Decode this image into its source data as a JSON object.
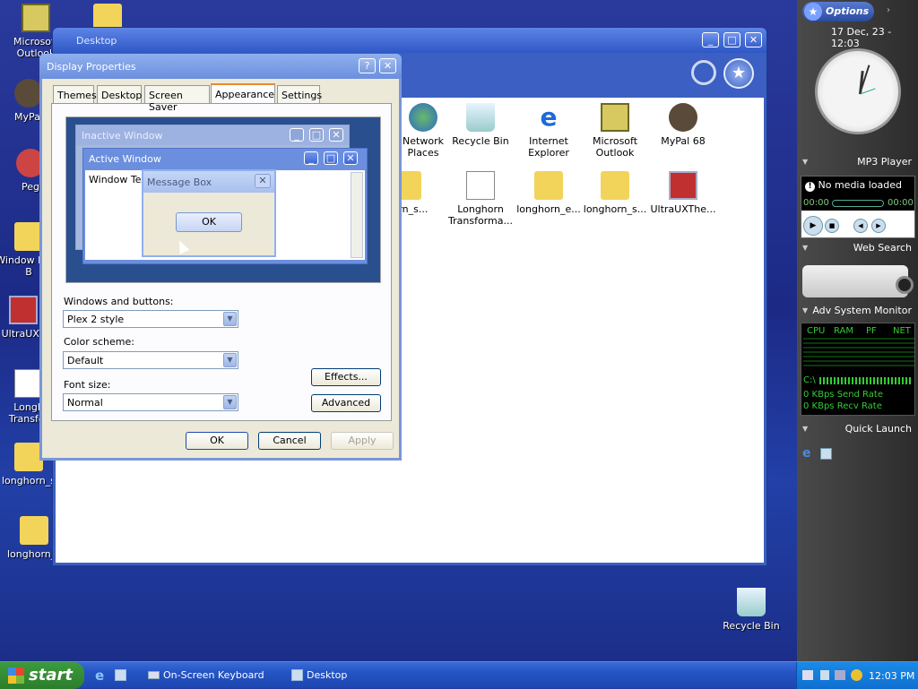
{
  "desktop_icons": [
    {
      "label": "Microsoft Outlook",
      "icon": "outlook-icon"
    },
    {
      "label": "MyPal",
      "icon": "mypal-icon"
    },
    {
      "label": "Peg",
      "icon": "peg-icon"
    },
    {
      "label": "Window Luna B",
      "icon": "zip-folder-icon"
    },
    {
      "label": "UltraUXT",
      "icon": "ultraux-icon"
    },
    {
      "label": "Longh Transfor",
      "icon": "document-icon"
    },
    {
      "label": "longhorn_s",
      "icon": "zip-folder-icon"
    },
    {
      "label": "longhorn_s",
      "icon": "folder-icon"
    },
    {
      "label": "Recycle Bin",
      "icon": "recycle-bin-icon"
    }
  ],
  "explorer": {
    "title": "Desktop",
    "items": [
      {
        "label": "Network Places",
        "icon": "network-icon"
      },
      {
        "label": "Recycle Bin",
        "icon": "recycle-bin-icon"
      },
      {
        "label": "Internet Explorer",
        "icon": "ie-icon"
      },
      {
        "label": "Microsoft Outlook",
        "icon": "outlook-icon"
      },
      {
        "label": "MyPal 68",
        "icon": "mypal-icon"
      },
      {
        "label": "horn_s...",
        "icon": "folder-icon"
      },
      {
        "label": "Longhorn Transforma...",
        "icon": "document-icon"
      },
      {
        "label": "longhorn_e...",
        "icon": "zip-folder-icon"
      },
      {
        "label": "longhorn_s...",
        "icon": "zip-folder-icon"
      },
      {
        "label": "UltraUXThe...",
        "icon": "ultraux-icon"
      }
    ]
  },
  "dialog": {
    "title": "Display Properties",
    "tabs": [
      "Themes",
      "Desktop",
      "Screen Saver",
      "Appearance",
      "Settings"
    ],
    "active_tab": "Appearance",
    "preview": {
      "inactive": "Inactive Window",
      "active": "Active Window",
      "window_text": "Window Text",
      "message_box": "Message Box",
      "ok": "OK"
    },
    "windows_buttons_label": "Windows and buttons:",
    "windows_buttons_value": "Plex 2 style",
    "color_scheme_label": "Color scheme:",
    "color_scheme_value": "Default",
    "font_size_label": "Font size:",
    "font_size_value": "Normal",
    "effects": "Effects...",
    "advanced": "Advanced",
    "ok": "OK",
    "cancel": "Cancel",
    "apply": "Apply"
  },
  "sidebar": {
    "options": "Options",
    "datetime": "17 Dec, 23 - 12:03",
    "mp3_title": "MP3 Player",
    "no_media": "No media loaded",
    "time_left": "00:00",
    "time_right": "00:00",
    "web_search": "Web Search",
    "sysmon_title": "Adv System Monitor",
    "sysmon_cols": [
      "CPU",
      "RAM",
      "PF",
      "NET"
    ],
    "drive": "C:\\",
    "send_rate": "0 KBps Send Rate",
    "recv_rate": "0 KBps Recv Rate",
    "quick_launch": "Quick Launch"
  },
  "taskbar": {
    "start": "start",
    "tasks": [
      "On-Screen Keyboard",
      "Desktop"
    ],
    "clock": "12:03 PM"
  }
}
